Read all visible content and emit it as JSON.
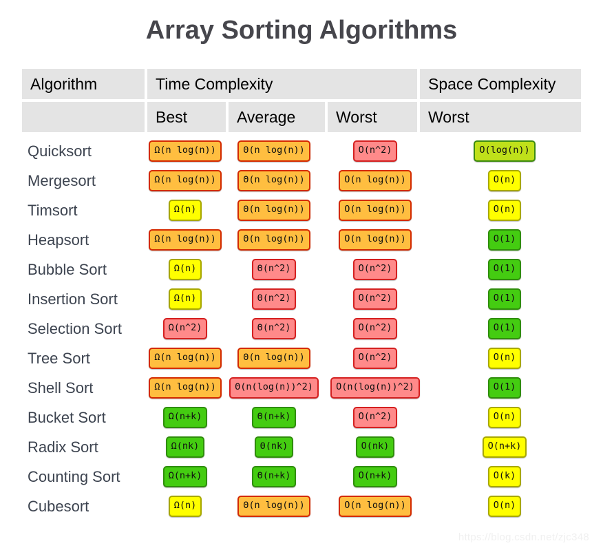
{
  "page_title": "Array Sorting Algorithms",
  "watermark": "https://blog.csdn.net/zjc348",
  "header": {
    "algorithm": "Algorithm",
    "time_complexity": "Time Complexity",
    "space_complexity": "Space Complexity",
    "blank": "",
    "best": "Best",
    "average": "Average",
    "worst": "Worst",
    "space_worst": "Worst"
  },
  "legend_colors": {
    "excellent_green": "#44cc11",
    "good_greenyellow": "#bfe01a",
    "fair_yellow": "#ffff00",
    "bad_orange": "#ffbe40",
    "horrible_red": "#ff8a8a",
    "header_background": "#e4e4e4",
    "title_color": "#46464c",
    "algorithm_name_color": "#3d4450",
    "page_background": "#ffffff"
  },
  "chart_data": {
    "type": "table",
    "title": "Array Sorting Algorithms",
    "columns": [
      "Algorithm",
      "Best",
      "Average",
      "Worst",
      "Space Worst"
    ],
    "column_groups": [
      {
        "label": "Algorithm",
        "span": 1
      },
      {
        "label": "Time Complexity",
        "span": 3
      },
      {
        "label": "Space Complexity",
        "span": 1
      }
    ],
    "rows": [
      {
        "algorithm": "Quicksort",
        "best": {
          "text": "Ω(n log(n))",
          "color": "orange"
        },
        "average": {
          "text": "Θ(n log(n))",
          "color": "orange"
        },
        "worst": {
          "text": "O(n^2)",
          "color": "red"
        },
        "space": {
          "text": "O(log(n))",
          "color": "greenyellow"
        }
      },
      {
        "algorithm": "Mergesort",
        "best": {
          "text": "Ω(n log(n))",
          "color": "orange"
        },
        "average": {
          "text": "Θ(n log(n))",
          "color": "orange"
        },
        "worst": {
          "text": "O(n log(n))",
          "color": "orange"
        },
        "space": {
          "text": "O(n)",
          "color": "yellow"
        }
      },
      {
        "algorithm": "Timsort",
        "best": {
          "text": "Ω(n)",
          "color": "yellow"
        },
        "average": {
          "text": "Θ(n log(n))",
          "color": "orange"
        },
        "worst": {
          "text": "O(n log(n))",
          "color": "orange"
        },
        "space": {
          "text": "O(n)",
          "color": "yellow"
        }
      },
      {
        "algorithm": "Heapsort",
        "best": {
          "text": "Ω(n log(n))",
          "color": "orange"
        },
        "average": {
          "text": "Θ(n log(n))",
          "color": "orange"
        },
        "worst": {
          "text": "O(n log(n))",
          "color": "orange"
        },
        "space": {
          "text": "O(1)",
          "color": "green"
        }
      },
      {
        "algorithm": "Bubble Sort",
        "best": {
          "text": "Ω(n)",
          "color": "yellow"
        },
        "average": {
          "text": "Θ(n^2)",
          "color": "red"
        },
        "worst": {
          "text": "O(n^2)",
          "color": "red"
        },
        "space": {
          "text": "O(1)",
          "color": "green"
        }
      },
      {
        "algorithm": "Insertion Sort",
        "best": {
          "text": "Ω(n)",
          "color": "yellow"
        },
        "average": {
          "text": "Θ(n^2)",
          "color": "red"
        },
        "worst": {
          "text": "O(n^2)",
          "color": "red"
        },
        "space": {
          "text": "O(1)",
          "color": "green"
        }
      },
      {
        "algorithm": "Selection Sort",
        "best": {
          "text": "Ω(n^2)",
          "color": "red"
        },
        "average": {
          "text": "Θ(n^2)",
          "color": "red"
        },
        "worst": {
          "text": "O(n^2)",
          "color": "red"
        },
        "space": {
          "text": "O(1)",
          "color": "green"
        }
      },
      {
        "algorithm": "Tree Sort",
        "best": {
          "text": "Ω(n log(n))",
          "color": "orange"
        },
        "average": {
          "text": "Θ(n log(n))",
          "color": "orange"
        },
        "worst": {
          "text": "O(n^2)",
          "color": "red"
        },
        "space": {
          "text": "O(n)",
          "color": "yellow"
        }
      },
      {
        "algorithm": "Shell Sort",
        "best": {
          "text": "Ω(n log(n))",
          "color": "orange"
        },
        "average": {
          "text": "Θ(n(log(n))^2)",
          "color": "red"
        },
        "worst": {
          "text": "O(n(log(n))^2)",
          "color": "red"
        },
        "space": {
          "text": "O(1)",
          "color": "green"
        }
      },
      {
        "algorithm": "Bucket Sort",
        "best": {
          "text": "Ω(n+k)",
          "color": "green"
        },
        "average": {
          "text": "Θ(n+k)",
          "color": "green"
        },
        "worst": {
          "text": "O(n^2)",
          "color": "red"
        },
        "space": {
          "text": "O(n)",
          "color": "yellow"
        }
      },
      {
        "algorithm": "Radix Sort",
        "best": {
          "text": "Ω(nk)",
          "color": "green"
        },
        "average": {
          "text": "Θ(nk)",
          "color": "green"
        },
        "worst": {
          "text": "O(nk)",
          "color": "green"
        },
        "space": {
          "text": "O(n+k)",
          "color": "yellow"
        }
      },
      {
        "algorithm": "Counting Sort",
        "best": {
          "text": "Ω(n+k)",
          "color": "green"
        },
        "average": {
          "text": "Θ(n+k)",
          "color": "green"
        },
        "worst": {
          "text": "O(n+k)",
          "color": "green"
        },
        "space": {
          "text": "O(k)",
          "color": "yellow"
        }
      },
      {
        "algorithm": "Cubesort",
        "best": {
          "text": "Ω(n)",
          "color": "yellow"
        },
        "average": {
          "text": "Θ(n log(n))",
          "color": "orange"
        },
        "worst": {
          "text": "O(n log(n))",
          "color": "orange"
        },
        "space": {
          "text": "O(n)",
          "color": "yellow"
        }
      }
    ]
  }
}
